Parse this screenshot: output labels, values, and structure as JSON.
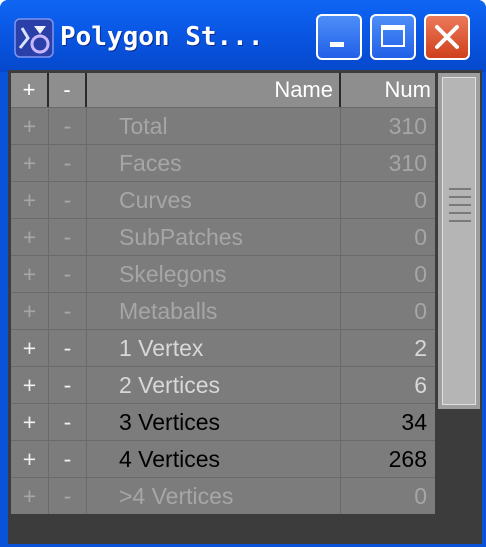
{
  "window": {
    "title": "Polygon St...",
    "buttons": {
      "minimize": "minimize",
      "maximize": "maximize",
      "close": "close"
    }
  },
  "table": {
    "header": {
      "plus": "+",
      "minus": "-",
      "name": "Name",
      "num": "Num"
    },
    "rows": [
      {
        "plus": "+",
        "minus": "-",
        "name": "Total",
        "num": "310",
        "state": "dim"
      },
      {
        "plus": "+",
        "minus": "-",
        "name": "Faces",
        "num": "310",
        "state": "dim"
      },
      {
        "plus": "+",
        "minus": "-",
        "name": "Curves",
        "num": "0",
        "state": "dim"
      },
      {
        "plus": "+",
        "minus": "-",
        "name": "SubPatches",
        "num": "0",
        "state": "dim"
      },
      {
        "plus": "+",
        "minus": "-",
        "name": "Skelegons",
        "num": "0",
        "state": "dim"
      },
      {
        "plus": "+",
        "minus": "-",
        "name": "Metaballs",
        "num": "0",
        "state": "dim"
      },
      {
        "plus": "+",
        "minus": "-",
        "name": "1 Vertex",
        "num": "2",
        "state": "mid"
      },
      {
        "plus": "+",
        "minus": "-",
        "name": "2 Vertices",
        "num": "6",
        "state": "mid"
      },
      {
        "plus": "+",
        "minus": "-",
        "name": "3 Vertices",
        "num": "34",
        "state": "bright"
      },
      {
        "plus": "+",
        "minus": "-",
        "name": "4 Vertices",
        "num": "268",
        "state": "bright"
      },
      {
        "plus": "+",
        "minus": "-",
        "name": ">4 Vertices",
        "num": "0",
        "state": "dim"
      }
    ]
  },
  "scrollbar": {
    "position_fraction": 0.0,
    "visible_fraction": 0.72
  }
}
